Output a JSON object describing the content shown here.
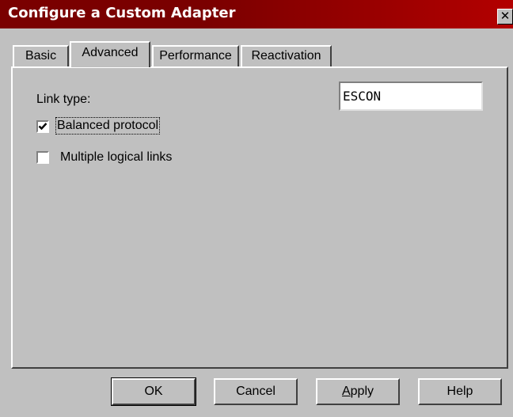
{
  "window": {
    "title": "Configure a Custom Adapter",
    "close_glyph": "✕"
  },
  "tabs": [
    {
      "label": "Basic",
      "active": false
    },
    {
      "label": "Advanced",
      "active": true
    },
    {
      "label": "Performance",
      "active": false
    },
    {
      "label": "Reactivation",
      "active": false
    }
  ],
  "form": {
    "link_type_label": "Link type:",
    "link_type_value": "ESCON",
    "balanced_protocol_label": "Balanced protocol",
    "balanced_protocol_checked": true,
    "multiple_links_label": "Multiple logical links",
    "multiple_links_checked": false
  },
  "buttons": {
    "ok": "OK",
    "cancel": "Cancel",
    "apply_mnemonic": "A",
    "apply_rest": "pply",
    "help": "Help"
  },
  "icons": {
    "close": "close-icon",
    "check": "checkmark-icon"
  },
  "colors": {
    "titlebar": "#7a0000",
    "face": "#c0c0c0"
  }
}
